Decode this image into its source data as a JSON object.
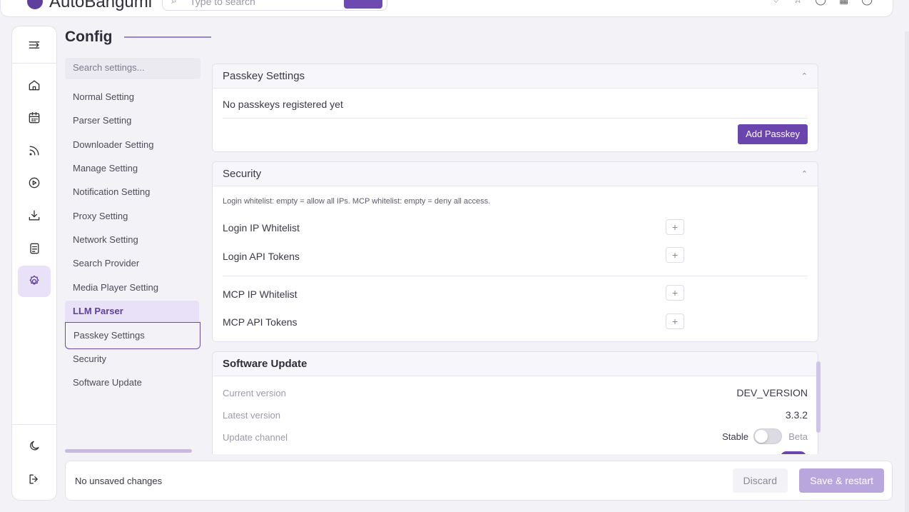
{
  "header": {
    "brand": "AutoBangumi",
    "search_placeholder": "Type to search"
  },
  "page": {
    "title": "Config"
  },
  "nav": {
    "search_placeholder": "Search settings...",
    "items": [
      "Normal Setting",
      "Parser Setting",
      "Downloader Setting",
      "Manage Setting",
      "Notification Setting",
      "Proxy Setting",
      "Network Setting",
      "Search Provider",
      "Media Player Setting",
      "LLM Parser",
      "Passkey Settings",
      "Security",
      "Software Update"
    ],
    "active_item": "LLM Parser"
  },
  "passkey": {
    "title": "Passkey Settings",
    "empty_text": "No passkeys registered yet",
    "add_button": "Add Passkey"
  },
  "security": {
    "title": "Security",
    "hint": "Login whitelist: empty = allow all IPs. MCP whitelist: empty = deny all access.",
    "login_ip_whitelist": "Login IP Whitelist",
    "login_api_tokens": "Login API Tokens",
    "mcp_ip_whitelist": "MCP IP Whitelist",
    "mcp_api_tokens": "MCP API Tokens",
    "add_symbol": "+"
  },
  "update": {
    "title": "Software Update",
    "current_version_label": "Current version",
    "current_version_value": "DEV_VERSION",
    "latest_version_label": "Latest version",
    "latest_version_value": "3.3.2",
    "update_channel_label": "Update channel",
    "channel_stable": "Stable",
    "channel_beta": "Beta"
  },
  "footer": {
    "status": "No unsaved changes",
    "discard": "Discard",
    "save_restart": "Save & restart"
  },
  "colors": {
    "accent": "#6a45ad",
    "accent_light": "#e9e1f7",
    "save_disabled": "#b9a6dd"
  }
}
